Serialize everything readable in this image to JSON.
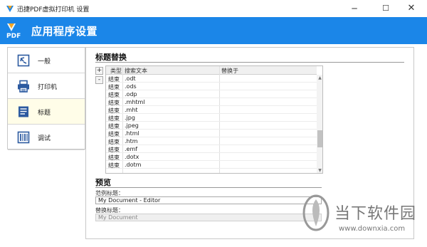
{
  "window": {
    "title": "迅捷PDF虚拟打印机 设置",
    "minimize_glyph": "─",
    "maximize_glyph": "☐",
    "close_glyph": "✕"
  },
  "header": {
    "logo_text": "PDF",
    "title": "应用程序设置",
    "color": "#1b86e8"
  },
  "sidebar": {
    "items": [
      {
        "label": "一般",
        "icon": "general-icon",
        "active": false
      },
      {
        "label": "打印机",
        "icon": "printer-icon",
        "active": false
      },
      {
        "label": "标题",
        "icon": "title-icon",
        "active": true
      },
      {
        "label": "调试",
        "icon": "debug-icon",
        "active": false
      }
    ]
  },
  "title_replace": {
    "heading": "标题替换",
    "add_label": "+",
    "remove_label": "-",
    "columns": [
      "类型",
      "搜索文本",
      "替换于"
    ],
    "rows": [
      {
        "type": "结束",
        "search": ".odt",
        "replace": ""
      },
      {
        "type": "结束",
        "search": ".ods",
        "replace": ""
      },
      {
        "type": "结束",
        "search": ".odp",
        "replace": ""
      },
      {
        "type": "结束",
        "search": ".mhtml",
        "replace": ""
      },
      {
        "type": "结束",
        "search": ".mht",
        "replace": ""
      },
      {
        "type": "结束",
        "search": ".jpg",
        "replace": ""
      },
      {
        "type": "结束",
        "search": ".jpeg",
        "replace": ""
      },
      {
        "type": "结束",
        "search": ".html",
        "replace": ""
      },
      {
        "type": "结束",
        "search": ".htm",
        "replace": ""
      },
      {
        "type": "结束",
        "search": ".emf",
        "replace": ""
      },
      {
        "type": "结束",
        "search": ".dotx",
        "replace": ""
      },
      {
        "type": "结束",
        "search": ".dotm",
        "replace": ""
      }
    ]
  },
  "preview": {
    "heading": "预览",
    "sample_label": "范例标题：",
    "sample_value": "My Document - Editor",
    "replaced_label": "替换标题：",
    "replaced_value": "My Document"
  },
  "watermark": {
    "brand": "当下软件园",
    "url": "www.downxia.com"
  }
}
